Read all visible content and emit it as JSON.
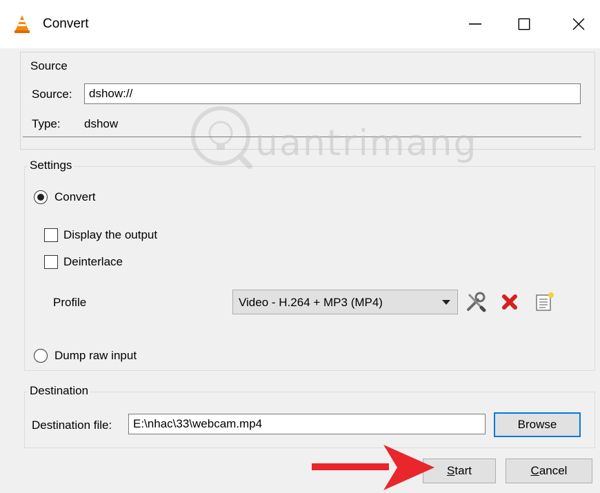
{
  "window": {
    "title": "Convert",
    "icons": {
      "app": "vlc-cone-icon",
      "minimize": "minimize-icon",
      "maximize": "maximize-icon",
      "close": "close-icon"
    }
  },
  "source": {
    "group_label": "Source",
    "source_label": "Source:",
    "source_value": "dshow://",
    "type_label": "Type:",
    "type_value": "dshow"
  },
  "settings": {
    "group_label": "Settings",
    "convert_label": "Convert",
    "convert_selected": true,
    "display_output_label": "Display the output",
    "display_output_checked": false,
    "deinterlace_label": "Deinterlace",
    "deinterlace_checked": false,
    "profile_label": "Profile",
    "profile_selected": "Video - H.264 + MP3 (MP4)",
    "profile_tools": [
      "wrench-screwdriver-icon",
      "delete-x-icon",
      "new-profile-icon"
    ],
    "dump_raw_label": "Dump raw input",
    "dump_raw_selected": false
  },
  "destination": {
    "group_label": "Destination",
    "file_label": "Destination file:",
    "file_value": "E:\\nhac\\33\\webcam.mp4",
    "browse_label": "Browse"
  },
  "actions": {
    "start_label": "Start",
    "cancel_label": "Cancel"
  },
  "overlay": {
    "watermark_text": "uantrimang",
    "arrow_color": "#e8262b"
  }
}
